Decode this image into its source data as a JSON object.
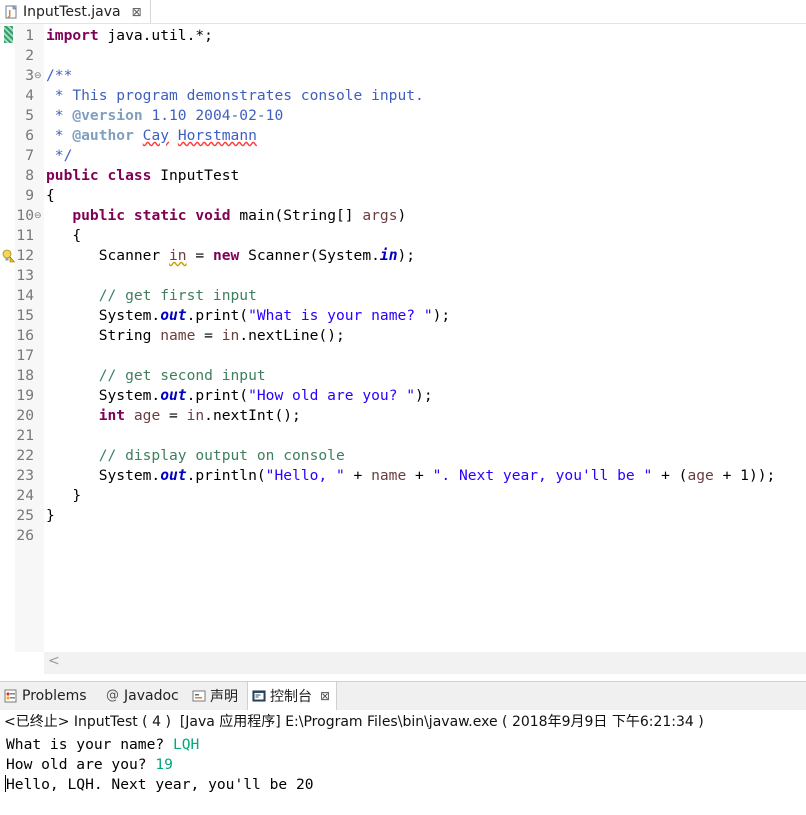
{
  "editor": {
    "tab_title": "InputTest.java",
    "tab_close": "⊠",
    "hscroll_arrow": "<",
    "lines": [
      {
        "n": "1",
        "fold": "",
        "s": [
          {
            "t": "import",
            "c": "kw"
          },
          {
            "t": " java.util.*;",
            "c": ""
          }
        ]
      },
      {
        "n": "2",
        "fold": "",
        "s": []
      },
      {
        "n": "3",
        "fold": "⊖",
        "s": [
          {
            "t": "/**",
            "c": "jd"
          }
        ]
      },
      {
        "n": "4",
        "fold": "",
        "s": [
          {
            "t": " * This program demonstrates console input.",
            "c": "jd"
          }
        ]
      },
      {
        "n": "5",
        "fold": "",
        "s": [
          {
            "t": " * ",
            "c": "jd"
          },
          {
            "t": "@version",
            "c": "jdt"
          },
          {
            "t": " 1.10 2004-02-10",
            "c": "jd"
          }
        ]
      },
      {
        "n": "6",
        "fold": "",
        "s": [
          {
            "t": " * ",
            "c": "jd"
          },
          {
            "t": "@author",
            "c": "jdt"
          },
          {
            "t": " ",
            "c": "jd"
          },
          {
            "t": "Cay",
            "c": "jd spell-ul"
          },
          {
            "t": " ",
            "c": "jd"
          },
          {
            "t": "Horstmann",
            "c": "jd spell-ul"
          }
        ]
      },
      {
        "n": "7",
        "fold": "",
        "s": [
          {
            "t": " */",
            "c": "jd"
          }
        ]
      },
      {
        "n": "8",
        "fold": "",
        "s": [
          {
            "t": "public",
            "c": "kw"
          },
          {
            "t": " ",
            "c": ""
          },
          {
            "t": "class",
            "c": "kw"
          },
          {
            "t": " InputTest",
            "c": ""
          }
        ]
      },
      {
        "n": "9",
        "fold": "",
        "s": [
          {
            "t": "{",
            "c": ""
          }
        ]
      },
      {
        "n": "10",
        "fold": "⊖",
        "s": [
          {
            "t": "   ",
            "c": ""
          },
          {
            "t": "public",
            "c": "kw"
          },
          {
            "t": " ",
            "c": ""
          },
          {
            "t": "static",
            "c": "kw"
          },
          {
            "t": " ",
            "c": ""
          },
          {
            "t": "void",
            "c": "kw"
          },
          {
            "t": " main(String[] ",
            "c": ""
          },
          {
            "t": "args",
            "c": "var"
          },
          {
            "t": ")",
            "c": ""
          }
        ]
      },
      {
        "n": "11",
        "fold": "",
        "s": [
          {
            "t": "   {",
            "c": ""
          }
        ]
      },
      {
        "n": "12",
        "fold": "",
        "s": [
          {
            "t": "      Scanner ",
            "c": ""
          },
          {
            "t": "in",
            "c": "var warn-ul"
          },
          {
            "t": " = ",
            "c": ""
          },
          {
            "t": "new",
            "c": "kw"
          },
          {
            "t": " Scanner(System.",
            "c": ""
          },
          {
            "t": "in",
            "c": "fld"
          },
          {
            "t": ");",
            "c": ""
          }
        ]
      },
      {
        "n": "13",
        "fold": "",
        "s": []
      },
      {
        "n": "14",
        "fold": "",
        "s": [
          {
            "t": "      // get first input",
            "c": "cm"
          }
        ]
      },
      {
        "n": "15",
        "fold": "",
        "s": [
          {
            "t": "      System.",
            "c": ""
          },
          {
            "t": "out",
            "c": "fld"
          },
          {
            "t": ".print(",
            "c": ""
          },
          {
            "t": "\"What is your name? \"",
            "c": "str"
          },
          {
            "t": ");",
            "c": ""
          }
        ]
      },
      {
        "n": "16",
        "fold": "",
        "s": [
          {
            "t": "      String ",
            "c": ""
          },
          {
            "t": "name",
            "c": "var"
          },
          {
            "t": " = ",
            "c": ""
          },
          {
            "t": "in",
            "c": "var"
          },
          {
            "t": ".nextLine();",
            "c": ""
          }
        ]
      },
      {
        "n": "17",
        "fold": "",
        "s": []
      },
      {
        "n": "18",
        "fold": "",
        "s": [
          {
            "t": "      // get second input",
            "c": "cm"
          }
        ]
      },
      {
        "n": "19",
        "fold": "",
        "s": [
          {
            "t": "      System.",
            "c": ""
          },
          {
            "t": "out",
            "c": "fld"
          },
          {
            "t": ".print(",
            "c": ""
          },
          {
            "t": "\"How old are you? \"",
            "c": "str"
          },
          {
            "t": ");",
            "c": ""
          }
        ]
      },
      {
        "n": "20",
        "fold": "",
        "s": [
          {
            "t": "      ",
            "c": ""
          },
          {
            "t": "int",
            "c": "kw"
          },
          {
            "t": " ",
            "c": ""
          },
          {
            "t": "age",
            "c": "var"
          },
          {
            "t": " = ",
            "c": ""
          },
          {
            "t": "in",
            "c": "var"
          },
          {
            "t": ".nextInt();",
            "c": ""
          }
        ]
      },
      {
        "n": "21",
        "fold": "",
        "s": []
      },
      {
        "n": "22",
        "fold": "",
        "s": [
          {
            "t": "      // display output on console",
            "c": "cm"
          }
        ]
      },
      {
        "n": "23",
        "fold": "",
        "s": [
          {
            "t": "      System.",
            "c": ""
          },
          {
            "t": "out",
            "c": "fld"
          },
          {
            "t": ".println(",
            "c": ""
          },
          {
            "t": "\"Hello, \"",
            "c": "str"
          },
          {
            "t": " + ",
            "c": ""
          },
          {
            "t": "name",
            "c": "var"
          },
          {
            "t": " + ",
            "c": ""
          },
          {
            "t": "\". Next year, you'll be \"",
            "c": "str"
          },
          {
            "t": " + (",
            "c": ""
          },
          {
            "t": "age",
            "c": "var"
          },
          {
            "t": " + 1));",
            "c": ""
          }
        ]
      },
      {
        "n": "24",
        "fold": "",
        "s": [
          {
            "t": "   }",
            "c": ""
          }
        ]
      },
      {
        "n": "25",
        "fold": "",
        "s": [
          {
            "t": "}",
            "c": ""
          }
        ]
      },
      {
        "n": "26",
        "fold": "",
        "s": []
      }
    ]
  },
  "views": {
    "tabs": [
      {
        "label": "Problems",
        "icon": "problems-icon"
      },
      {
        "label": "Javadoc",
        "icon": "javadoc-at-icon"
      },
      {
        "label": "声明",
        "icon": "declaration-icon"
      },
      {
        "label": "控制台",
        "icon": "console-icon",
        "active": true
      }
    ],
    "close": "⊠",
    "at_glyph": "@"
  },
  "console": {
    "header": "<已终止> InputTest ( 4 )  [Java 应用程序] E:\\Program Files\\bin\\javaw.exe ( 2018年9月9日 下午6:21:34 )",
    "lines": [
      {
        "prompt": "What is your name? ",
        "input": "LQH"
      },
      {
        "prompt": "How old are you? ",
        "input": "19"
      },
      {
        "prompt": "Hello, LQH. Next year, you'll be 20",
        "input": ""
      }
    ]
  },
  "colors": {
    "keyword": "#7f0055",
    "comment": "#3f7f5f",
    "javadoc": "#3f5fbf",
    "string": "#2a00ff",
    "field": "#0000c0",
    "local_var": "#6a3e3e",
    "console_input": "#00a87a"
  }
}
